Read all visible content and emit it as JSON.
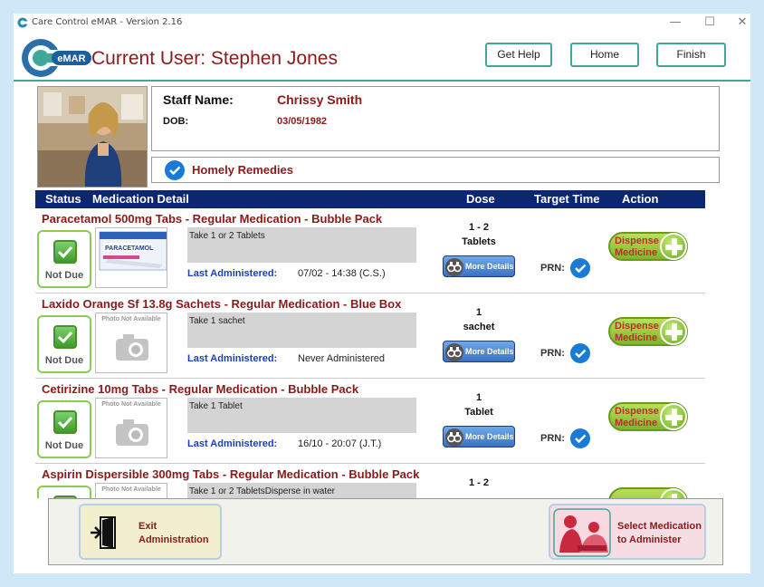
{
  "window": {
    "title": "Care Control eMAR - Version 2.16",
    "minimize": "—",
    "maximize": "☐",
    "close": "✕"
  },
  "header": {
    "logo_text": "eMAR",
    "current_user": "Current User: Stephen Jones",
    "buttons": {
      "help": "Get Help",
      "home": "Home",
      "finish": "Finish"
    }
  },
  "staff": {
    "name_label": "Staff Name:",
    "name": "Chrissy Smith",
    "dob_label": "DOB:",
    "dob": "03/05/1982",
    "homely_remedies": "Homely Remedies"
  },
  "table": {
    "columns": {
      "status": "Status",
      "detail": "Medication Detail",
      "dose": "Dose",
      "target": "Target Time",
      "action": "Action"
    }
  },
  "medications": [
    {
      "title": "Paracetamol 500mg Tabs - Regular Medication - Bubble Pack",
      "status": "Not Due",
      "image": "paracetamol-box",
      "box_brand": "PARACETAMOL",
      "instructions": "Take 1 or 2 Tablets",
      "last_label": "Last Administered:",
      "last_value": "07/02 - 14:38 (C.S.)",
      "dose_qty": "1 - 2",
      "dose_unit": "Tablets",
      "details_label": "More Details",
      "prn_label": "PRN:",
      "dispense_line1": "Dispense",
      "dispense_line2": "Medicine"
    },
    {
      "title": "Laxido Orange Sf 13.8g Sachets - Regular Medication - Blue Box",
      "status": "Not Due",
      "image": "photo-not-available",
      "photo_na": "Photo Not Available",
      "instructions": "Take 1 sachet",
      "last_label": "Last Administered:",
      "last_value": "Never Administered",
      "dose_qty": "1",
      "dose_unit": "sachet",
      "details_label": "More Details",
      "prn_label": "PRN:",
      "dispense_line1": "Dispense",
      "dispense_line2": "Medicine"
    },
    {
      "title": "Cetirizine 10mg Tabs - Regular Medication - Bubble Pack",
      "status": "Not Due",
      "image": "photo-not-available",
      "photo_na": "Photo Not Available",
      "instructions": "Take 1 Tablet",
      "last_label": "Last Administered:",
      "last_value": "16/10 - 20:07 (J.T.)",
      "dose_qty": "1",
      "dose_unit": "Tablet",
      "details_label": "More Details",
      "prn_label": "PRN:",
      "dispense_line1": "Dispense",
      "dispense_line2": "Medicine"
    },
    {
      "title": "Aspirin Dispersible 300mg Tabs - Regular Medication - Bubble Pack",
      "status": "",
      "image": "photo-not-available",
      "photo_na": "Photo Not Available",
      "instructions": "Take 1 or 2 TabletsDisperse in water",
      "dose_qty": "1 - 2"
    }
  ],
  "footer": {
    "exit_line1": "Exit",
    "exit_line2": "Administration",
    "select_line1": "Select Medication",
    "select_line2": "to Administer"
  },
  "colors": {
    "accent_teal": "#3fa89a",
    "brand_red": "#8b1a1a",
    "header_navy": "#0d2670",
    "link_blue": "#1a3fc0",
    "check_blue": "#1a7ad8",
    "status_green": "#8ccb54",
    "page_bg": "#cfe8f7"
  }
}
